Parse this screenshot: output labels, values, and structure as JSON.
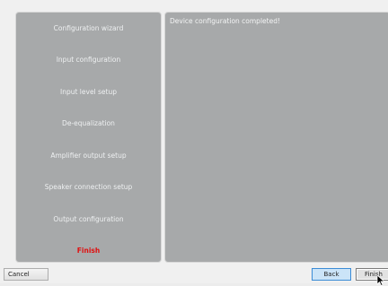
{
  "wizard": {
    "steps": [
      {
        "label": "Configuration wizard",
        "current": false
      },
      {
        "label": "Input configuration",
        "current": false
      },
      {
        "label": "Input level setup",
        "current": false
      },
      {
        "label": "De-equalization",
        "current": false
      },
      {
        "label": "Amplifier output setup",
        "current": false
      },
      {
        "label": "Speaker connection setup",
        "current": false
      },
      {
        "label": "Output configuration",
        "current": false
      },
      {
        "label": "Finish",
        "current": true
      }
    ],
    "message": "Device configuration completed!"
  },
  "buttons": {
    "cancel": "Cancel",
    "back": "Back",
    "finish": "Finish"
  },
  "colors": {
    "panel": "#a7a9aa",
    "current_step": "#e01010",
    "back_button": "#cbe4f8"
  },
  "icons": {
    "cursor": "cursor-arrow-icon"
  }
}
